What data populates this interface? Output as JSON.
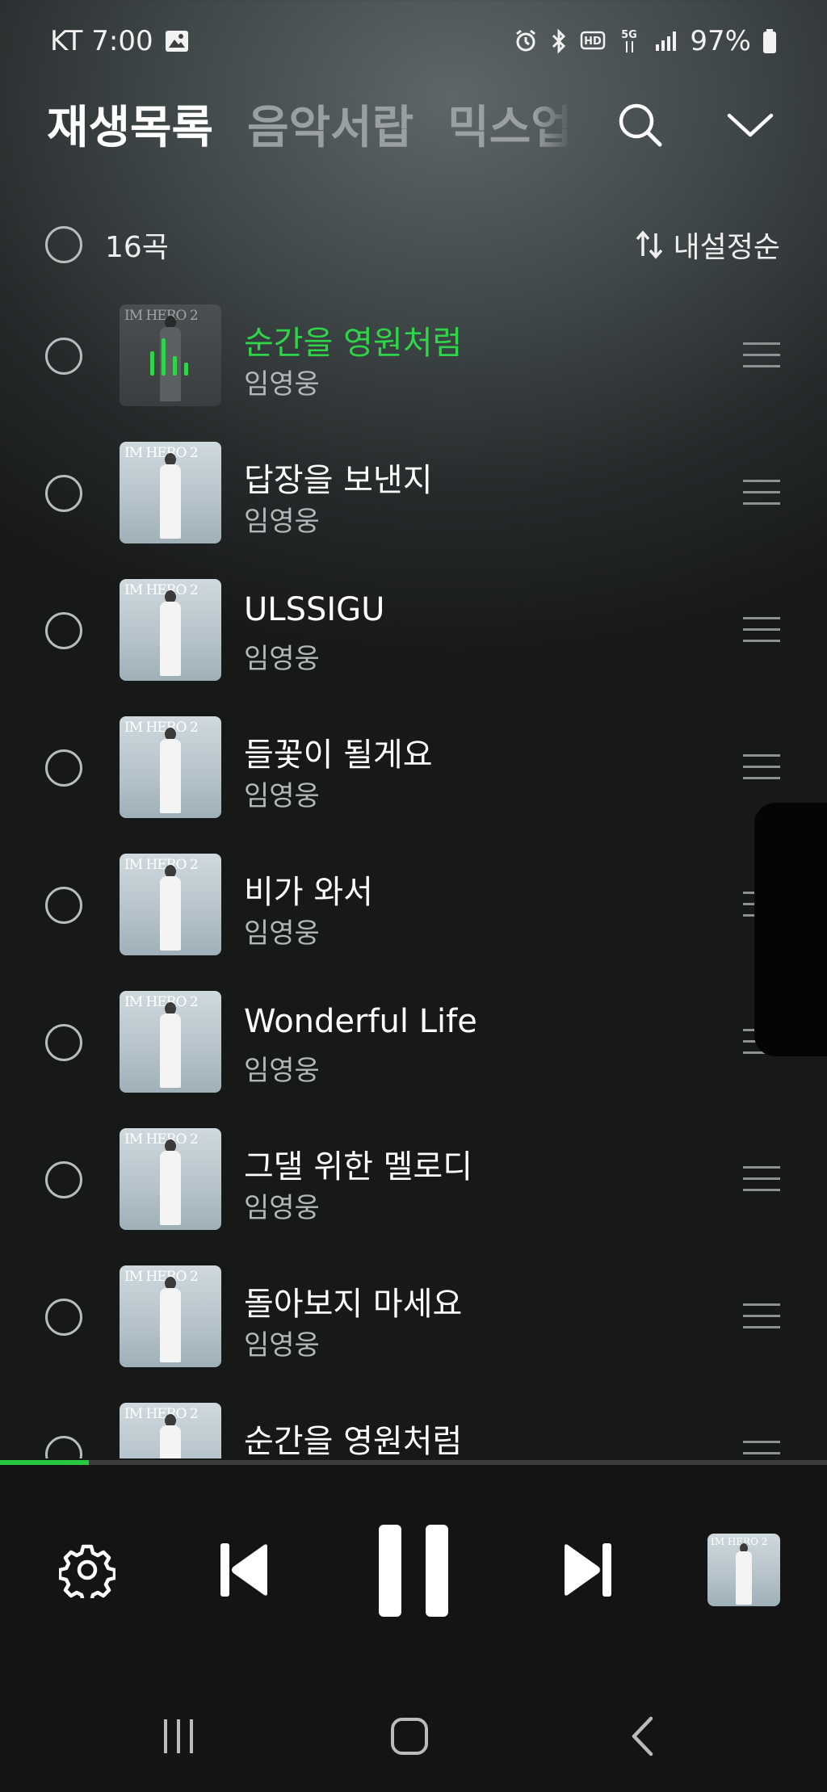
{
  "status": {
    "carrier_time": "KT 7:00",
    "battery": "97%",
    "icons": [
      "image-icon",
      "alarm-icon",
      "bluetooth-icon",
      "hd-voice-icon",
      "5g-icon",
      "signal-icon",
      "battery-icon"
    ]
  },
  "header": {
    "tabs": [
      {
        "label": "재생목록",
        "active": true
      },
      {
        "label": "음악서랍",
        "active": false
      },
      {
        "label": "믹스업",
        "active": false
      }
    ]
  },
  "list_header": {
    "count": "16곡",
    "sort_label": "내설정순"
  },
  "album_art_text": "IM HERO 2",
  "songs": [
    {
      "title": "순간을 영원처럼",
      "artist": "임영웅",
      "playing": true
    },
    {
      "title": "답장을 보낸지",
      "artist": "임영웅",
      "playing": false
    },
    {
      "title": "ULSSIGU",
      "artist": "임영웅",
      "playing": false
    },
    {
      "title": "들꽃이 될게요",
      "artist": "임영웅",
      "playing": false
    },
    {
      "title": "비가 와서",
      "artist": "임영웅",
      "playing": false
    },
    {
      "title": "Wonderful Life",
      "artist": "임영웅",
      "playing": false
    },
    {
      "title": "그댈 위한 멜로디",
      "artist": "임영웅",
      "playing": false
    },
    {
      "title": "돌아보지 마세요",
      "artist": "임영웅",
      "playing": false
    },
    {
      "title": "순간을 영원처럼",
      "artist": "",
      "playing": false
    }
  ],
  "player": {
    "progress_fraction": 0.107
  },
  "colors": {
    "accent_green": "#2fd548",
    "background": "#2a2e2f"
  }
}
